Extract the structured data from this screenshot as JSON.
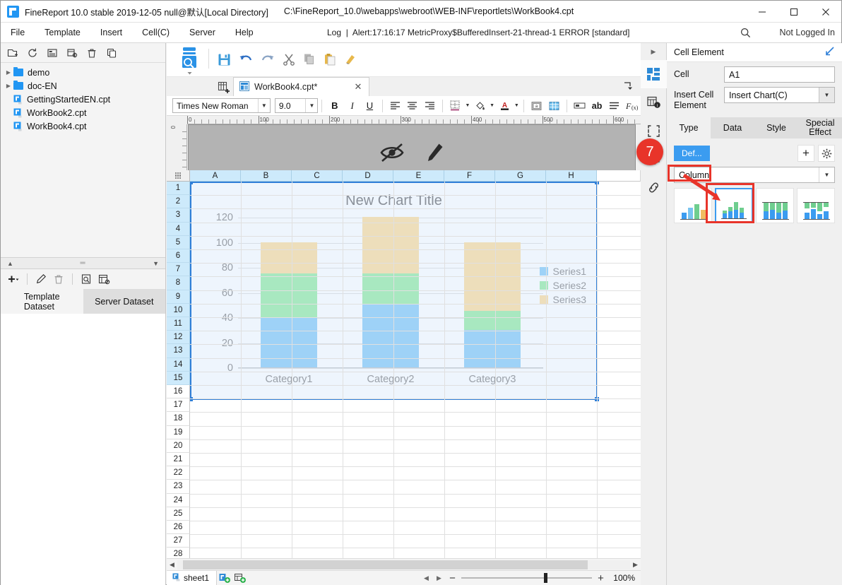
{
  "window": {
    "title": "FineReport 10.0 stable 2019-12-05 null@默认[Local Directory]",
    "path": "C:\\FineReport_10.0\\webapps\\webroot\\WEB-INF\\reportlets\\WorkBook4.cpt",
    "minimize": "—",
    "maximize": "□",
    "close": "✕"
  },
  "menu": {
    "items": [
      "File",
      "Template",
      "Insert",
      "Cell(C)",
      "Server",
      "Help"
    ],
    "log_label": "Log",
    "log_message": "Alert:17:16:17 MetricProxy$BufferedInsert-21-thread-1 ERROR [standard]",
    "login_status": "Not Logged In"
  },
  "left_panel": {
    "toolbar_icons": [
      "new-template-icon",
      "refresh-icon",
      "template-list-icon",
      "config-icon",
      "delete-icon",
      "copy-icon"
    ],
    "tree": [
      {
        "label": "demo",
        "type": "folder",
        "expandable": true
      },
      {
        "label": "doc-EN",
        "type": "folder",
        "expandable": true
      },
      {
        "label": "GettingStartedEN.cpt",
        "type": "file",
        "expandable": false
      },
      {
        "label": "WorkBook2.cpt",
        "type": "file",
        "expandable": false
      },
      {
        "label": "WorkBook4.cpt",
        "type": "file",
        "expandable": false
      }
    ],
    "dataset_toolbar_icons": [
      "add-dataset-icon",
      "edit-dataset-icon",
      "delete-dataset-icon",
      "preview-dataset-icon",
      "dataset-settings-icon"
    ],
    "dataset_tabs": [
      {
        "label": "Template\nDataset",
        "selected": false
      },
      {
        "label": "Server Dataset",
        "selected": true
      }
    ]
  },
  "center": {
    "toolbar_icons": [
      "preview-icon",
      "save-icon",
      "undo-icon",
      "redo-icon",
      "cut-icon",
      "copy-icon",
      "paste-icon",
      "format-painter-icon"
    ],
    "new_tab_icon": "new-sheet-icon",
    "doc_tab": {
      "label": "WorkBook4.cpt*",
      "close": "✕"
    },
    "format_bar": {
      "font_family": "Times New Roman",
      "font_size": "9.0",
      "bold": "B",
      "italic": "I",
      "underline": "U",
      "icons": [
        "align-left-icon",
        "align-center-icon",
        "align-right-icon",
        "border-icon",
        "fill-color-icon",
        "font-color-icon",
        "merge-cells-icon",
        "table-icon",
        "cell-attr-icon",
        "text-ab-icon",
        "line-style-icon",
        "formula-icon"
      ]
    },
    "ruler": {
      "h_labels": [
        "0",
        "100",
        "200",
        "300",
        "400",
        "500",
        "600"
      ],
      "v_label": "0"
    },
    "design_icons": [
      "hide-eye-icon",
      "pencil-edit-icon"
    ],
    "columns": [
      "A",
      "B",
      "C",
      "D",
      "E",
      "F",
      "G",
      "H"
    ],
    "rows": [
      1,
      2,
      3,
      4,
      5,
      6,
      7,
      8,
      9,
      10,
      11,
      12,
      13,
      14,
      15,
      16,
      17,
      18,
      19,
      20,
      21,
      22,
      23,
      24,
      25,
      26,
      27,
      28
    ],
    "selected_rows_through": 15,
    "status": {
      "sheet_name": "sheet1",
      "sheet_icons": [
        "add-sheet-icon",
        "add-polyblock-icon"
      ],
      "zoom_minus": "−",
      "zoom_plus": "+",
      "zoom_value": "100%"
    }
  },
  "chart_data": {
    "type": "bar",
    "stacked": true,
    "title": "New Chart Title",
    "categories": [
      "Category1",
      "Category2",
      "Category3"
    ],
    "series": [
      {
        "name": "Series1",
        "color": "#9ed2f7",
        "values": [
          40,
          50,
          30
        ]
      },
      {
        "name": "Series2",
        "color": "#a8e8c0",
        "values": [
          35,
          25,
          15
        ]
      },
      {
        "name": "Series3",
        "color": "#eddebb",
        "values": [
          25,
          45,
          55
        ]
      }
    ],
    "yticks": [
      0,
      20,
      40,
      60,
      80,
      100,
      120
    ],
    "ylim": [
      0,
      120
    ],
    "xlabel": "",
    "ylabel": "",
    "grid": true,
    "legend_position": "right",
    "plot_background": "#eef5fd"
  },
  "right_panel": {
    "rail_icons": [
      "collapse-arrow-icon",
      "cell-element-icon",
      "cell-attribute-icon",
      "frame-icon",
      "float-element-icon",
      "hyperlink-icon"
    ],
    "header": {
      "title": "Cell Element",
      "expand_icon": "expand-arrow-icon"
    },
    "fields": [
      {
        "label": "Cell",
        "value": "A1",
        "type": "input"
      },
      {
        "label": "Insert Cell Element",
        "value": "Insert Chart(C)",
        "type": "select"
      }
    ],
    "tabs": [
      {
        "label": "Type",
        "active": true
      },
      {
        "label": "Data",
        "active": false
      },
      {
        "label": "Style",
        "active": false
      },
      {
        "label": "Special Effect",
        "active": false
      }
    ],
    "default_button": "Def...",
    "add_icon": "plus-icon",
    "settings_icon": "gear-icon",
    "chart_type": "Column",
    "chart_subtypes": [
      {
        "name": "column-chart-thumb",
        "selected": false
      },
      {
        "name": "stacked-column-chart-thumb",
        "selected": true
      },
      {
        "name": "percent-stacked-column-chart-thumb",
        "selected": false
      },
      {
        "name": "custom-stacked-column-chart-thumb",
        "selected": false
      }
    ]
  },
  "annotations": {
    "step_badge": "7",
    "highlight_color": "#e8342a"
  }
}
